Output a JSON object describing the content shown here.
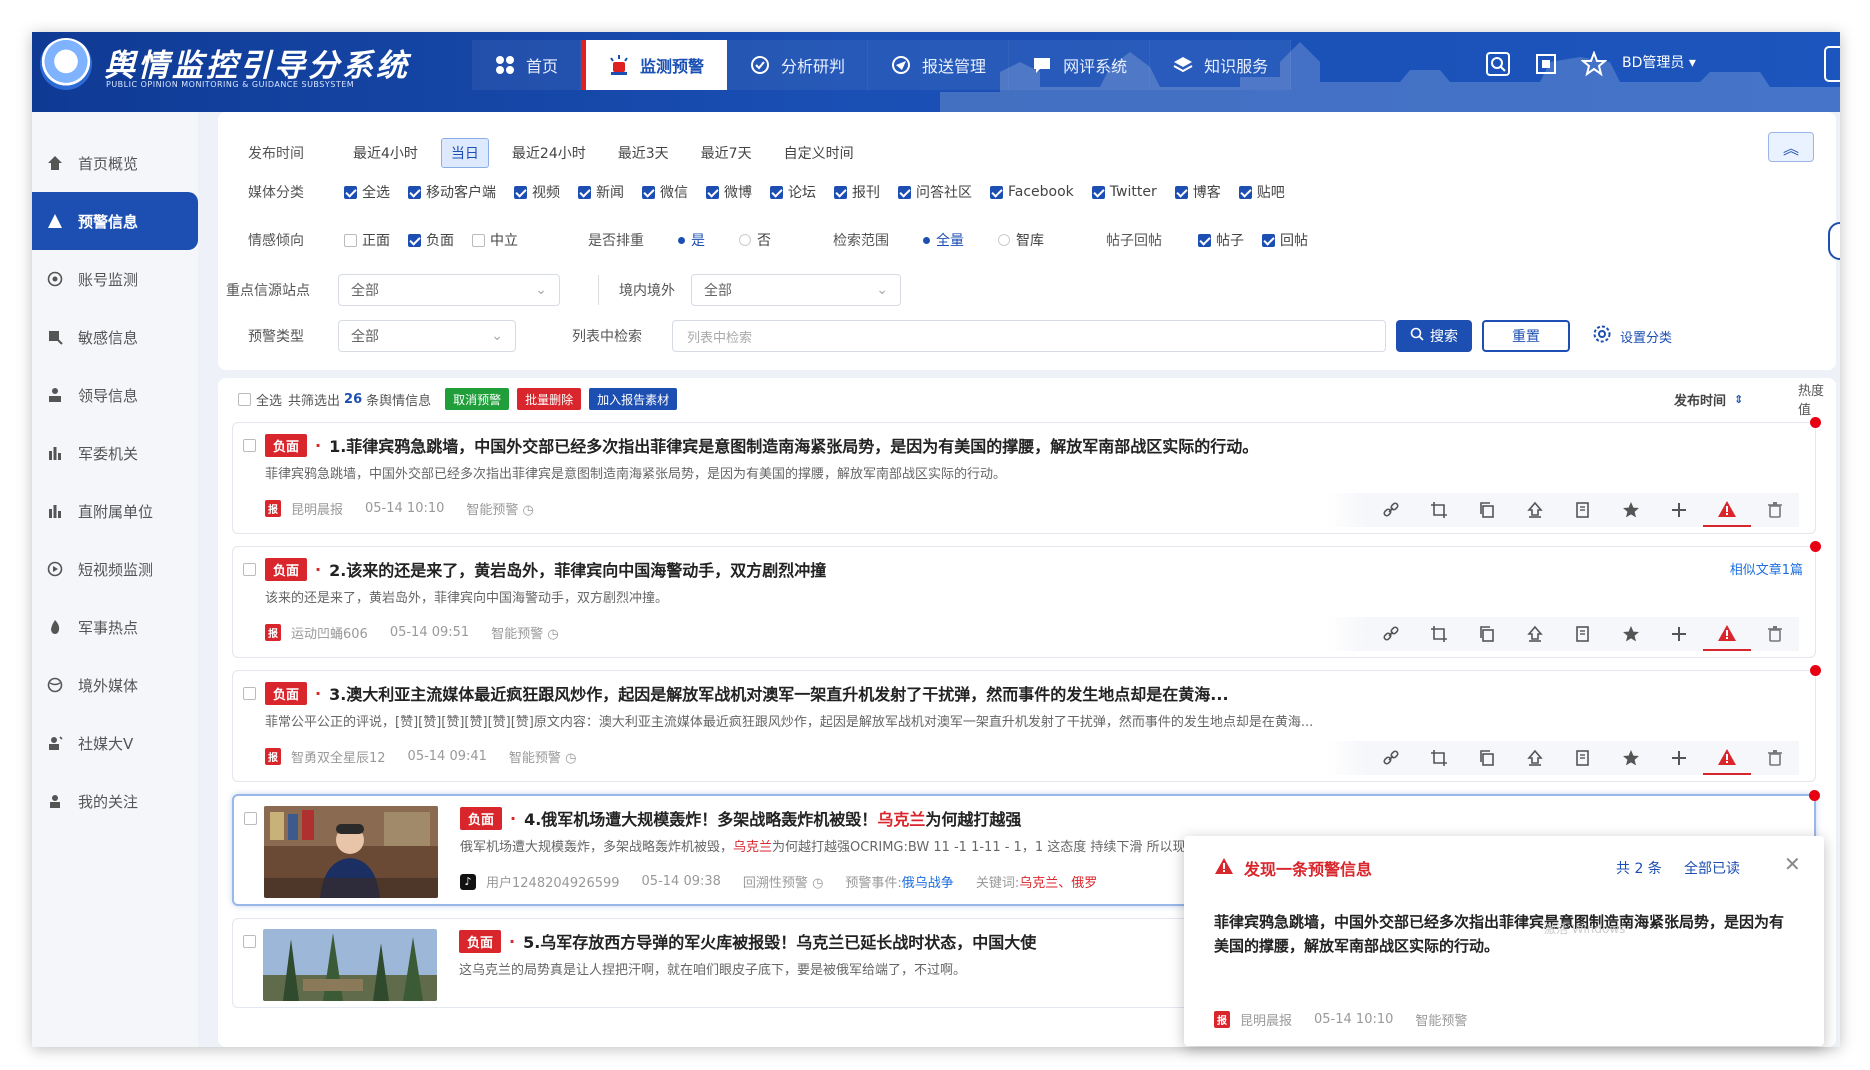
{
  "header": {
    "app_title": "舆情监控引导分系统",
    "app_subtitle": "PUBLIC OPINION MONITORING & GUIDANCE SUBSYSTEM",
    "nav": [
      {
        "label": "首页",
        "icon": "grid-icon"
      },
      {
        "label": "监测预警",
        "icon": "alarm-icon"
      },
      {
        "label": "分析研判",
        "icon": "analysis-icon"
      },
      {
        "label": "报送管理",
        "icon": "send-icon"
      },
      {
        "label": "网评系统",
        "icon": "comment-icon"
      },
      {
        "label": "知识服务",
        "icon": "layers-icon"
      }
    ],
    "user": "BD管理员 ▾"
  },
  "sidebar": {
    "items": [
      {
        "label": "首页概览",
        "icon": "home-icon"
      },
      {
        "label": "预警信息",
        "icon": "warning-icon"
      },
      {
        "label": "账号监测",
        "icon": "account-icon"
      },
      {
        "label": "敏感信息",
        "icon": "sensitive-icon"
      },
      {
        "label": "领导信息",
        "icon": "leader-icon"
      },
      {
        "label": "军委机关",
        "icon": "building-icon"
      },
      {
        "label": "直附属单位",
        "icon": "unit-icon"
      },
      {
        "label": "短视频监测",
        "icon": "video-icon"
      },
      {
        "label": "军事热点",
        "icon": "fire-icon"
      },
      {
        "label": "境外媒体",
        "icon": "globe-icon"
      },
      {
        "label": "社媒大V",
        "icon": "vip-icon"
      },
      {
        "label": "我的关注",
        "icon": "follow-icon"
      }
    ]
  },
  "filter": {
    "time": {
      "label": "发布时间",
      "options": [
        "最近4小时",
        "当日",
        "最近24小时",
        "最近3天",
        "最近7天",
        "自定义时间"
      ],
      "selected": "当日"
    },
    "media": {
      "label": "媒体分类",
      "options": [
        "全选",
        "移动客户端",
        "视频",
        "新闻",
        "微信",
        "微博",
        "论坛",
        "报刊",
        "问答社区",
        "Facebook",
        "Twitter",
        "博客",
        "贴吧"
      ]
    },
    "sentiment": {
      "label": "情感倾向",
      "options": [
        "正面",
        "负面",
        "中立"
      ],
      "checked": "负面"
    },
    "dedupe": {
      "label": "是否排重",
      "yes": "是",
      "no": "否"
    },
    "scope": {
      "label": "检索范围",
      "all": "全量",
      "lib": "智库"
    },
    "reply": {
      "label": "帖子回帖",
      "post": "帖子",
      "reply": "回帖"
    },
    "site": {
      "label": "重点信源站点",
      "value": "全部"
    },
    "region": {
      "label": "境内境外",
      "value": "全部"
    },
    "warn_type": {
      "label": "预警类型",
      "value": "全部"
    },
    "search": {
      "label": "列表中检索",
      "placeholder": "列表中检索",
      "button": "搜索",
      "reset": "重置",
      "settings": "设置分类"
    }
  },
  "list": {
    "select_all": "全选",
    "summary_prefix": "共筛选出",
    "count": "26",
    "summary_suffix": "条舆情信息",
    "buttons": [
      "取消预警",
      "批量删除",
      "加入报告素材"
    ],
    "sort_label": "发布时间",
    "heat_label": "热度值",
    "items": [
      {
        "tag": "负面",
        "title": "1.菲律宾鸦急跳墙，中国外交部已经多次指出菲律宾是意图制造南海紧张局势，是因为有美国的撑腰，解放军南部战区实际的行动。",
        "snippet": "菲律宾鸦急跳墙，中国外交部已经多次指出菲律宾是意图制造南海紧张局势，是因为有美国的撑腰，解放军南部战区实际的行动。",
        "source": "昆明晨报",
        "time": "05-14 10:10",
        "warn": "智能预警"
      },
      {
        "tag": "负面",
        "title": "2.该来的还是来了，黄岩岛外，菲律宾向中国海警动手，双方剧烈冲撞",
        "snippet": "该来的还是来了，黄岩岛外，菲律宾向中国海警动手，双方剧烈冲撞。",
        "source": "运动凹蛹606",
        "time": "05-14 09:51",
        "warn": "智能预警",
        "similar": "相似文章1篇"
      },
      {
        "tag": "负面",
        "title": "3.澳大利亚主流媒体最近疯狂跟风炒作，起因是解放军战机对澳军一架直升机发射了干扰弹，然而事件的发生地点却是在黄海...",
        "snippet": "菲常公平公正的评说，[赞][赞][赞][赞][赞][赞]原文内容：澳大利亚主流媒体最近疯狂跟风炒作，起因是解放军战机对澳军一架直升机发射了干扰弹，然而事件的发生地点却是在黄海...",
        "source": "智勇双全星辰12",
        "time": "05-14 09:41",
        "warn": "智能预警"
      },
      {
        "tag": "负面",
        "title_a": "4.俄军机场遭大规模轰炸！多架战略轰炸机被毁！",
        "title_kw": "乌克兰",
        "title_b": "为何越打越强",
        "snippet_a": "俄军机场遭大规模轰炸，多架战略轰炸机被毁，",
        "snippet_kw": "乌克兰",
        "snippet_b": "为何越打越强OCRIMG:BW 11 -1 1-11 - 1，1 这态度 持续下滑 所以现 这批军援 1- 美地利也公开反对 跑到前线 1-1 十多架其...",
        "source": "用户1248204926599",
        "time": "05-14 09:38",
        "warn": "回溯性预警",
        "event_label": "预警事件:",
        "event": "俄乌战争",
        "kw_label": "关键词:",
        "kw": "乌克兰、俄罗"
      },
      {
        "tag": "负面",
        "title": "5.乌军存放西方导弹的军火库被报毁！乌克兰已延长战时状态，中国大使",
        "snippet": "这乌克兰的局势真是让人捏把汗啊，就在咱们眼皮子底下，要是被俄军给端了，不过啊。"
      }
    ]
  },
  "popup": {
    "title": "发现一条预警信息",
    "count": "共 2 条",
    "read_all": "全部已读",
    "close": "✕",
    "body": "菲律宾鸦急跳墙，中国外交部已经多次指出菲律宾是意图制造南海紧张局势，是因为有美国的撑腰，解放军南部战区实际的行动。",
    "source": "昆明晨报",
    "time": "05-14 10:10",
    "warn": "智能预警",
    "watermark": "激活 Windows"
  },
  "colors": {
    "primary": "#1d4fb2",
    "header": "#1a4fb4",
    "negative": "#d9262c",
    "green": "#1f9e3a"
  }
}
